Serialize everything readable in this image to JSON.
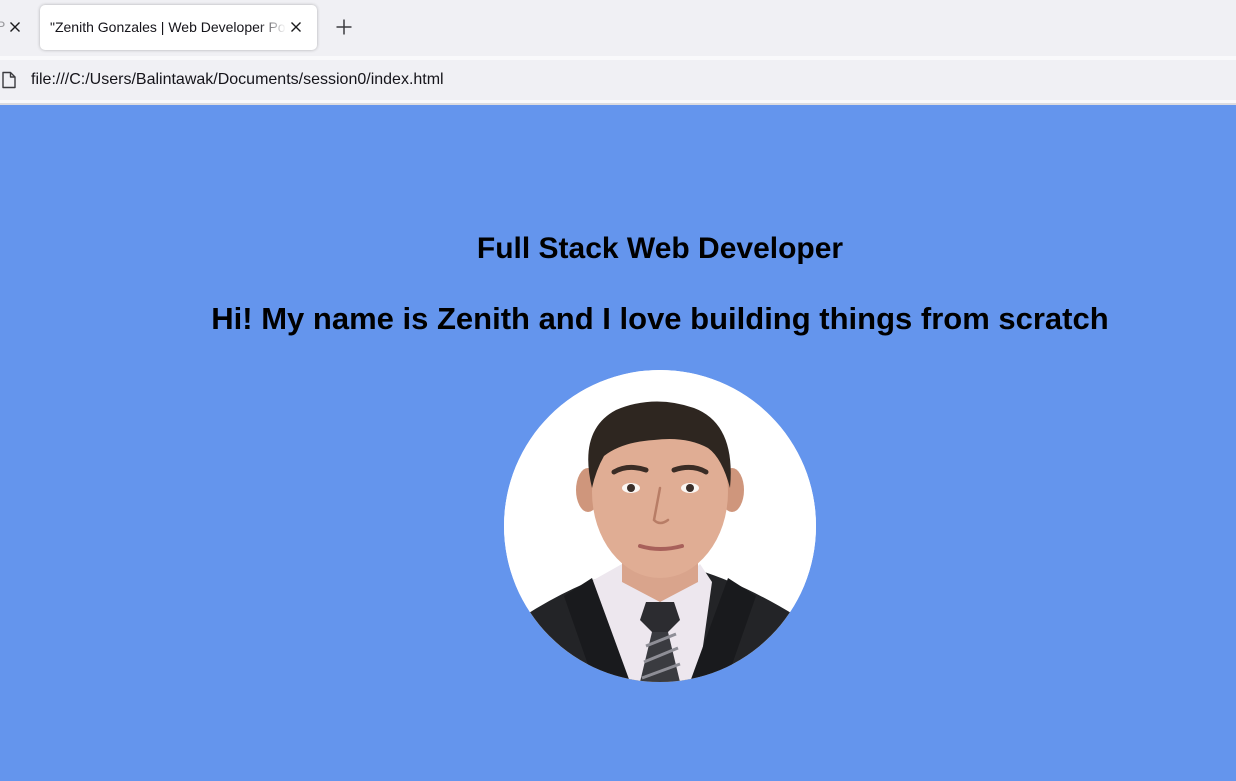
{
  "browser": {
    "tabs": [
      {
        "label": "P",
        "active": false
      },
      {
        "label": "\"Zenith Gonzales | Web Developer Portfolio",
        "active": true
      }
    ],
    "new_tab_icon": "plus-icon",
    "close_icon": "close-icon",
    "address": "file:///C:/Users/Balintawak/Documents/session0/index.html",
    "page_icon": "page-icon"
  },
  "page": {
    "background_color": "#6495ed",
    "title": "Full Stack Web Developer",
    "subtitle": "Hi! My name is Zenith and I love building things from scratch",
    "portrait": "profile-photo"
  }
}
